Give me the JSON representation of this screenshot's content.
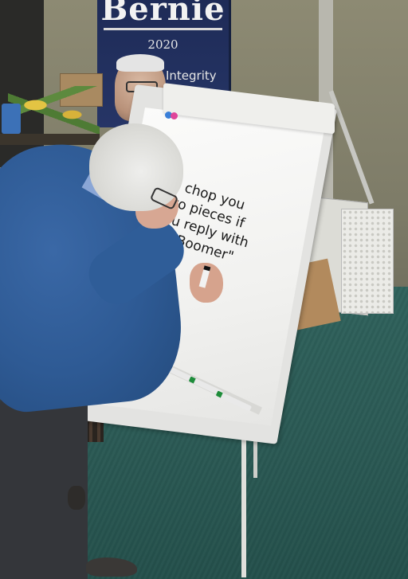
{
  "photo": {
    "banner": {
      "title": "Bernie",
      "year": "2020",
      "word": "Integrity"
    },
    "whiteboard": {
      "lines": [
        "I'll chop you",
        "into pieces if",
        "you reply with",
        "\"ok Boomer\""
      ]
    }
  }
}
